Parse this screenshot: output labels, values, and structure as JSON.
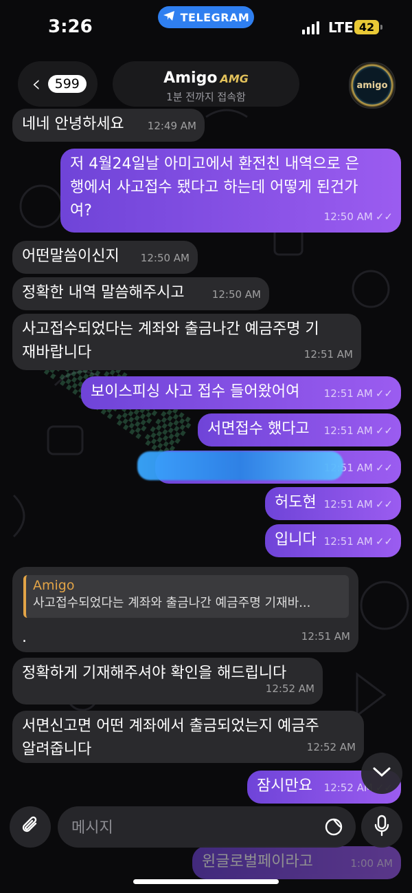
{
  "status": {
    "time": "3:26",
    "app_pill": "TELEGRAM",
    "network": "LTE",
    "battery": "42"
  },
  "header": {
    "back_count": "599",
    "name": "Amigo",
    "badge": "AMG",
    "status": "1분 전까지 접속함",
    "avatar_text": "amigo"
  },
  "colors": {
    "incoming": "#2a2a2d",
    "outgoing_start": "#6f44d8",
    "outgoing_end": "#9b5cf0",
    "reply_accent": "#e2a447",
    "pill": "#2f7ff0"
  },
  "messages": [
    {
      "dir": "in",
      "lines": [
        "네네 안녕하세요"
      ],
      "time": "12:49 AM"
    },
    {
      "dir": "out",
      "lines": [
        "저 4월24일날 아미고에서 환전친 내역으로 은",
        "행에서 사고접수 됐다고 하는데 어떻게 된건가",
        "여?"
      ],
      "time": "12:50 AM"
    },
    {
      "dir": "in",
      "lines": [
        "어떤말씀이신지"
      ],
      "time": "12:50 AM"
    },
    {
      "dir": "in",
      "lines": [
        "정확한 내역 말씀해주시고"
      ],
      "time": "12:50 AM"
    },
    {
      "dir": "in",
      "lines": [
        "사고접수되었다는 계좌와 출금나간 예금주명 기",
        "재바랍니다"
      ],
      "time": "12:51 AM"
    },
    {
      "dir": "out",
      "lines": [
        "보이스피싱 사고 접수 들어왔어여"
      ],
      "time": "12:51 AM"
    },
    {
      "dir": "out",
      "lines": [
        "서면접수 했다고"
      ],
      "time": "12:51 AM"
    },
    {
      "dir": "out",
      "lines": [
        ""
      ],
      "time": "12:51 AM"
    },
    {
      "dir": "out",
      "lines": [
        "허도현"
      ],
      "time": "12:51 AM"
    },
    {
      "dir": "out",
      "lines": [
        "입니다"
      ],
      "time": "12:51 AM"
    },
    {
      "dir": "in",
      "lines": [
        "."
      ],
      "time": "12:51 AM",
      "reply": {
        "name": "Amigo",
        "text": "사고접수되었다는 계좌와 출금나간 예금주명 기재바..."
      }
    },
    {
      "dir": "in",
      "lines": [
        "정확하게 기재해주셔야 확인을 해드립니다"
      ],
      "time": "12:52 AM"
    },
    {
      "dir": "in",
      "lines": [
        "서면신고면 어떤 계좌에서 출금되었는지 예금주",
        "알려줍니다"
      ],
      "time": "12:52 AM"
    },
    {
      "dir": "out",
      "lines": [
        "잠시만요"
      ],
      "time": "12:52 AM"
    },
    {
      "dir": "out",
      "lines": [
        "윈글로벌페이라고"
      ],
      "time": "1:00 AM"
    }
  ],
  "composer": {
    "placeholder": "메시지"
  },
  "icons": {
    "back": "chevron-left-icon",
    "attach": "paperclip-icon",
    "sticker": "sticker-icon",
    "mic": "microphone-icon",
    "scroll": "chevron-down-icon",
    "read": "double-check-icon"
  }
}
